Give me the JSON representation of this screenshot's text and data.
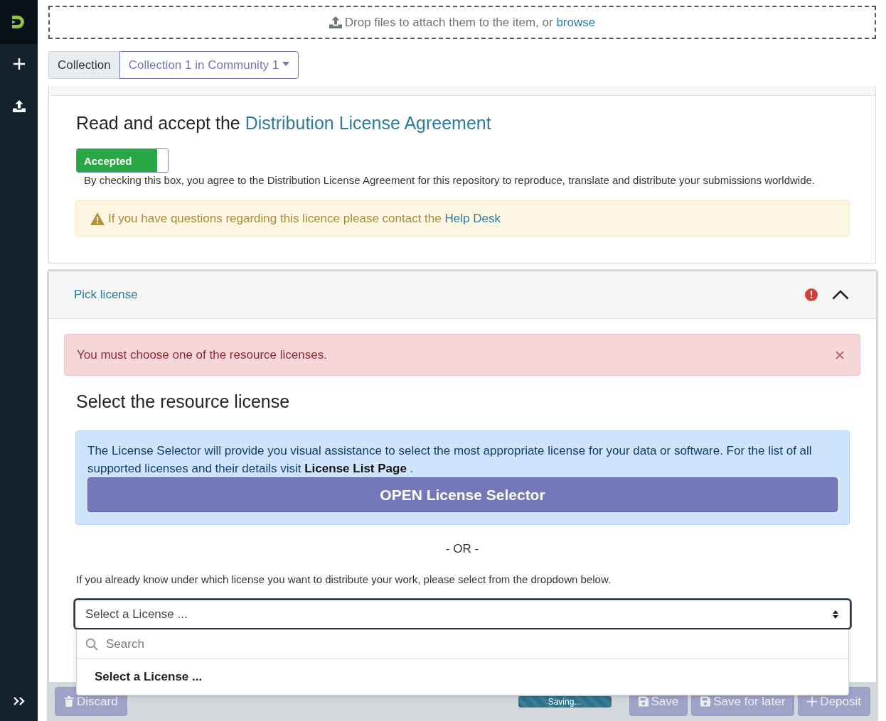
{
  "upload": {
    "text": "Drop files to attach them to the item, or",
    "link": "browse"
  },
  "collection": {
    "label": "Collection",
    "value": "Collection 1 in Community 1"
  },
  "license_agreement": {
    "title": "Read and accept the",
    "title_link": "Distribution License Agreement",
    "toggle": {
      "label": "Accepted",
      "on": true
    },
    "note": "By checking this box, you agree to the Distribution License Agreement for this repository to reproduce, translate and distribute your submissions worldwide.",
    "warning": {
      "text": "If you have questions regarding this licence please contact the",
      "link": "Help Desk"
    }
  },
  "pick_license": {
    "title": "Pick license",
    "invalid": true,
    "expanded": true,
    "error": "You must choose one of the resource licenses.",
    "heading": "Select the resource license",
    "info": {
      "text": "The License Selector will provide you visual assistance to select the most appropriate license for your data or software. For the list of all supported licenses and their details visit **License List Page** .",
      "button": "OPEN License Selector"
    },
    "separator": "- OR -",
    "hint": "If you already know under which license you want to distribute your work, please select from the dropdown below.",
    "select": {
      "value": "Select a License ...",
      "open": true,
      "search": {
        "placeholder": "Search"
      },
      "options": [
        {
          "label": "Select a License ...",
          "selected": true
        }
      ]
    }
  },
  "footer": {
    "left_buttons": [
      {
        "label": "Discard",
        "kind": "discard",
        "disabled": true
      }
    ],
    "progress": {
      "label": "Saving...",
      "level": 1
    },
    "right_buttons": [
      {
        "label": "Save",
        "kind": "save",
        "disabled": true
      },
      {
        "label": "Save for later",
        "kind": "save_later",
        "disabled": true
      },
      {
        "label": "Deposit",
        "kind": "deposit",
        "disabled": true
      }
    ]
  }
}
